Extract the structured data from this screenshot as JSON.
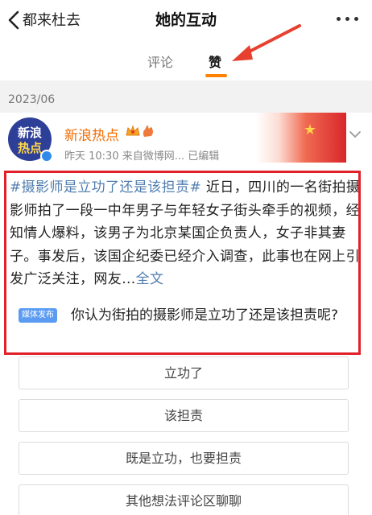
{
  "nav": {
    "back_label": "都来杜去",
    "title": "她的互动",
    "more_icon": "more-dots-icon"
  },
  "tabs": [
    {
      "label": "评论",
      "active": false
    },
    {
      "label": "赞",
      "active": true
    }
  ],
  "colors": {
    "accent": "#ff8200",
    "link": "#507daf",
    "author_name": "#f36b00",
    "highlight_box": "#e0212a",
    "annotation_arrow": "#e8402f",
    "media_badge": "#5b9cf2"
  },
  "feed": {
    "date_header": "2023/06",
    "post": {
      "avatar_text": [
        "新浪",
        "热点"
      ],
      "author": "新浪热点",
      "author_badges": [
        "crown-icon",
        "hand-icon"
      ],
      "meta": "昨天 10:30  来自微博网...  已编辑",
      "hashtag": "#摄影师是立功了还是该担责#",
      "body": " 近日，四川的一名街拍摄影师拍了一段一中年男子与年轻女子街头牵手的视频，经知情人爆料，该男子为北京某国企负责人，女子非其妻子。事发后，该国企纪委已经介入调查，此事也在网上引发广泛关注，网友...",
      "full_text_link": "全文",
      "poll": {
        "badge": "媒体发布",
        "question": "你认为街拍的摄影师是立功了还是该担责呢?",
        "options": [
          "立功了",
          "该担责",
          "既是立功，也要担责",
          "其他想法评论区聊聊"
        ]
      }
    }
  }
}
